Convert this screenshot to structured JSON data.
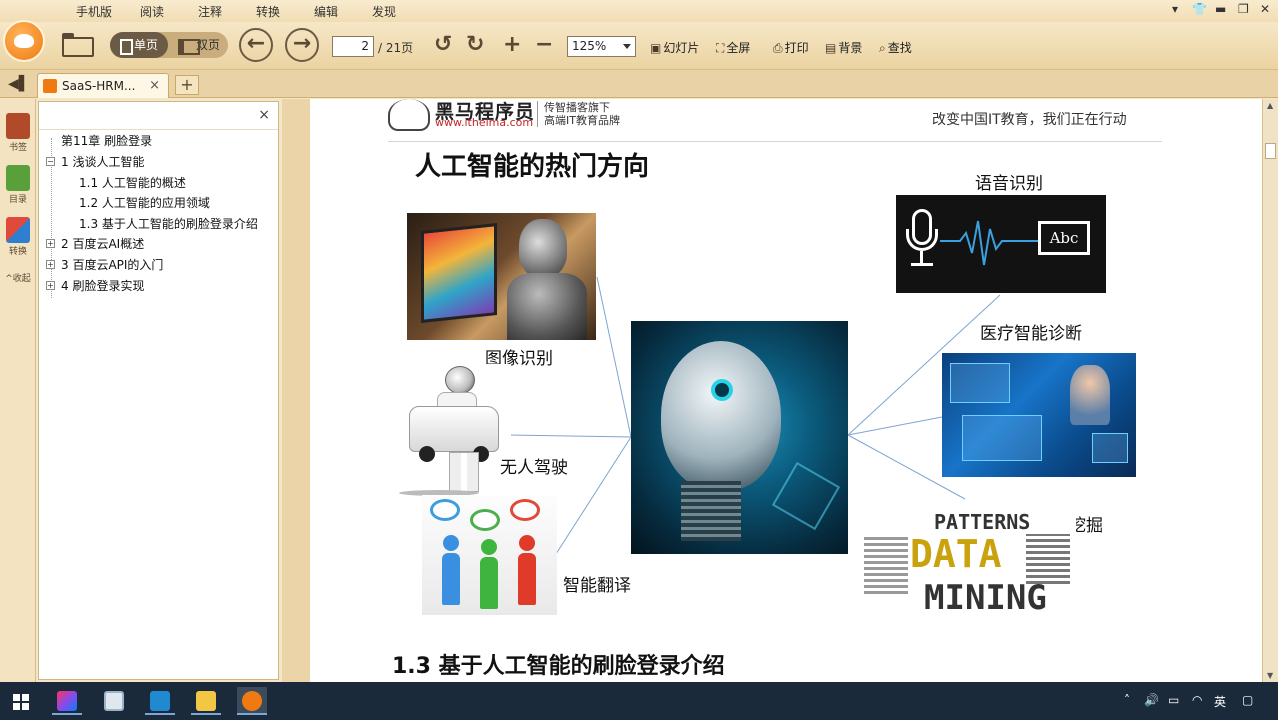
{
  "menu": {
    "items": [
      "手机版",
      "阅读",
      "注释",
      "转换",
      "编辑",
      "发现"
    ]
  },
  "toolbar": {
    "single_page": "单页",
    "double_page": "双页",
    "current_page": "2",
    "total_pages": "/ 21页",
    "zoom": "125%",
    "slideshow": "幻灯片",
    "fullscreen": "全屏",
    "print": "打印",
    "background": "背景",
    "find": "查找"
  },
  "tab": {
    "title": "SaaS-HRM...",
    "close": "×",
    "new": "+"
  },
  "rail": {
    "bookmarks": "书签",
    "outline": "目录",
    "convert": "转换",
    "collapse": "^收起"
  },
  "outline": {
    "close": "×",
    "items": [
      "第11章 刷脸登录",
      "1 浅谈人工智能",
      "1.1 人工智能的概述",
      "1.2 人工智能的应用领域",
      "1.3 基于人工智能的刷脸登录介绍",
      "2 百度云AI概述",
      "3 百度云API的入门",
      "4 刷脸登录实现"
    ]
  },
  "document": {
    "brand_name": "黑马程序员",
    "brand_url": "www.itheima.com",
    "brand_tag1": "传智播客旗下",
    "brand_tag2": "高端IT教育品牌",
    "slogan": "改变中国IT教育，我们正在行动",
    "title": "人工智能的热门方向",
    "captions": {
      "image_recognition": "图像识别",
      "speech_recognition": "语音识别",
      "medical_diagnosis": "医疗智能诊断",
      "self_driving": "无人驾驶",
      "data_mining": "数据挖掘",
      "translation": "智能翻译"
    },
    "voice_box": "Abc",
    "mining_words": [
      "PATTERNS",
      "DATA",
      "MINING"
    ],
    "section_title": "1.3 基于人工智能的刷脸登录介绍"
  },
  "taskbar": {
    "tray_ime": "英"
  }
}
